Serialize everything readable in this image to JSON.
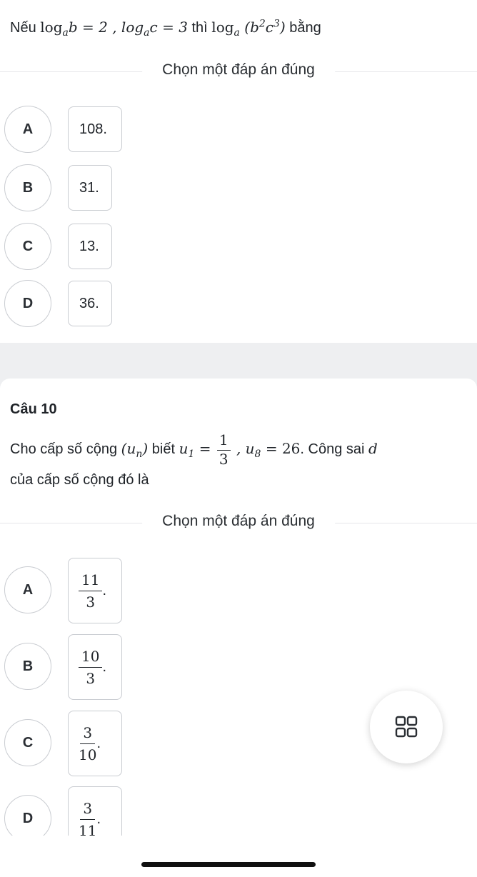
{
  "q9": {
    "text_prefix": "Nếu ",
    "expr_1": "log",
    "expr_1_sub": "a",
    "expr_1_rest": "b = 2 , log",
    "expr_2_sub": "a",
    "expr_2_rest": "c = 3",
    "text_mid": " thì ",
    "expr_3": "log",
    "expr_3_sub": "a",
    "expr_3_body": "(b",
    "expr_3_sup1": "2",
    "expr_3_body2": "c",
    "expr_3_sup2": "3",
    "expr_3_close": ")",
    "text_suffix": " bằng",
    "choose_label": "Chọn một đáp án đúng",
    "options": [
      {
        "letter": "A",
        "value": "108."
      },
      {
        "letter": "B",
        "value": "31."
      },
      {
        "letter": "C",
        "value": "13."
      },
      {
        "letter": "D",
        "value": "36."
      }
    ]
  },
  "q10": {
    "title": "Câu 10",
    "line1_prefix": "Cho cấp số cộng ",
    "seq": "(u",
    "seq_sub": "n",
    "seq_close": ")",
    "line1_mid": " biết ",
    "u1": "u",
    "u1_sub": "1",
    "u1_eq": " = ",
    "u1_num": "1",
    "u1_den": "3",
    "u8": " , u",
    "u8_sub": "8",
    "u8_eq": " = 26",
    "line1_suffix": ". Công sai ",
    "d": "d",
    "line2": "của cấp số cộng đó là",
    "choose_label": "Chọn một đáp án đúng",
    "options": [
      {
        "letter": "A",
        "num": "11",
        "den": "3",
        "dot": "."
      },
      {
        "letter": "B",
        "num": "10",
        "den": "3",
        "dot": "."
      },
      {
        "letter": "C",
        "num": "3",
        "den": "10",
        "dot": "."
      },
      {
        "letter": "D",
        "num": "3",
        "den": "11",
        "dot": "."
      }
    ]
  },
  "fab": {
    "icon": "grid-icon"
  }
}
